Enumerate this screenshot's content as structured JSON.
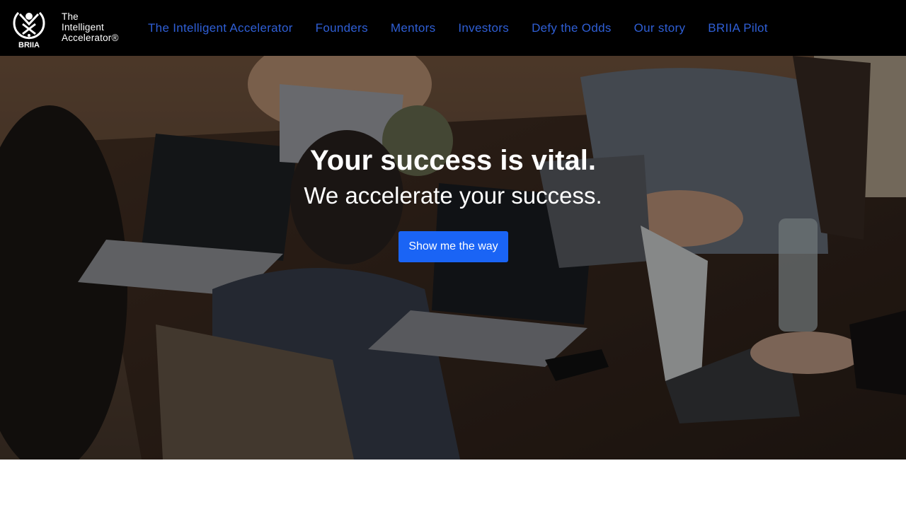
{
  "logo": {
    "brand": "BRIIA",
    "tagline_line1": "The",
    "tagline_line2": "Intelligent",
    "tagline_line3": "Accelerator®"
  },
  "nav": {
    "items": [
      {
        "label": "The Intelligent Accelerator"
      },
      {
        "label": "Founders"
      },
      {
        "label": "Mentors"
      },
      {
        "label": "Investors"
      },
      {
        "label": "Defy the Odds"
      },
      {
        "label": "Our story"
      },
      {
        "label": "BRIIA Pilot"
      }
    ]
  },
  "hero": {
    "title": "Your success is vital.",
    "subtitle": "We accelerate your success.",
    "cta_label": "Show me the way"
  },
  "colors": {
    "navbar_bg": "#000000",
    "nav_link": "#2f5fd6",
    "cta_bg": "#1a64f5"
  }
}
